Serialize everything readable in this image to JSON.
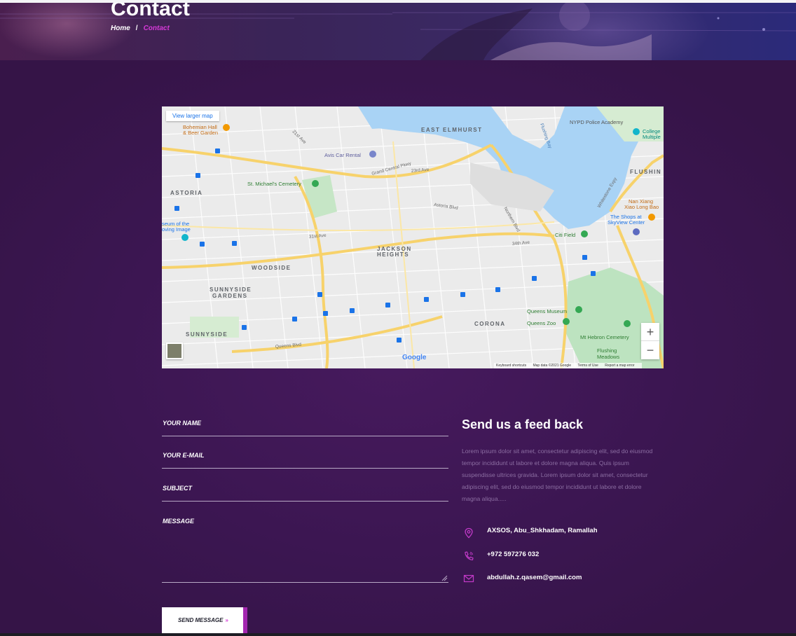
{
  "hero": {
    "title": "Contact",
    "breadcrumb": {
      "home": "Home",
      "separator": "/",
      "current": "Contact"
    }
  },
  "map": {
    "view_larger_label": "View larger map",
    "places": {
      "east_elmhurst": "EAST ELMHURST",
      "astoria": "ASTORIA",
      "woodside": "WOODSIDE",
      "sunnyside_gardens_1": "SUNNYSIDE",
      "sunnyside_gardens_2": "GARDENS",
      "sunnyside": "SUNNYSIDE",
      "jackson_heights_1": "JACKSON",
      "jackson_heights_2": "HEIGHTS",
      "corona": "CORONA",
      "flushing": "FLUSHIN",
      "bohemian_hall_1": "Bohemian Hall",
      "bohemian_hall_2": "& Beer Garden",
      "avis": "Avis Car Rental",
      "st_michaels": "St. Michael's Cemetery",
      "nypd": "NYPD Police Academy",
      "citi_field": "Citi Field",
      "queens_museum": "Queens Museum",
      "queens_zoo": "Queens Zoo",
      "mt_hebron": "Mt Hebron Cemetery",
      "flushing_meadows_1": "Flushing",
      "flushing_meadows_2": "Meadows",
      "museum_moving_image_1": "seum of the",
      "museum_moving_image_2": "oving Image",
      "shops_skyview_1": "The Shops at",
      "shops_skyview_2": "SkyView Center",
      "nan_xiang_1": "Nan Xiang",
      "nan_xiang_2": "Xiao Long Bao",
      "college_1": "College",
      "college_2": "Multiple",
      "flushing_bay": "Flushing Bay",
      "grand_central_pkwy": "Grand Central Pkwy",
      "queens_blvd": "Queens Blvd",
      "whitestone": "Whitestone Expy",
      "astoria_blvd": "Astoria Blvd",
      "northern_blvd": "Northern Blvd",
      "roosevelt_ave": "34th Ave",
      "ave_31": "31st Ave",
      "ave_23": "23rd Ave",
      "ave_21": "21st Ave"
    },
    "google_logo": "Google",
    "footer": {
      "shortcuts": "Keyboard shortcuts",
      "map_data": "Map data ©2021 Google",
      "terms": "Terms of Use",
      "report": "Report a map error"
    },
    "zoom_in": "+",
    "zoom_out": "−"
  },
  "form": {
    "name_label": "YOUR NAME",
    "email_label": "YOUR E-MAIL",
    "subject_label": "SUBJECT",
    "message_label": "MESSAGE",
    "send_label": "SEND MESSAGE",
    "send_arrow": "»"
  },
  "feedback": {
    "title": "Send us a feed back",
    "text": "Lorem ipsum dolor sit amet, consectetur adipiscing elit, sed do eiusmod tempor incididunt ut labore et dolore magna aliqua. Quis ipsum suspendisse ultrices gravida. Lorem ipsum dolor sit amet, consectetur adipiscing elit, sed do eiusmod tempor incididunt ut labore et dolore magna aliqua.....",
    "address": "AXSOS, Abu_Shkhadam, Ramallah",
    "phone": "+972 597276 032",
    "email": "abdullah.z.qasem@gmail.com"
  },
  "colors": {
    "background": "#3a1650",
    "accent": "#d63ad8",
    "button_shadow": "#a327b0",
    "muted_text": "#8c6ea2"
  },
  "icons": {
    "address": "map-pin-icon",
    "phone": "phone-icon",
    "email": "envelope-icon"
  }
}
